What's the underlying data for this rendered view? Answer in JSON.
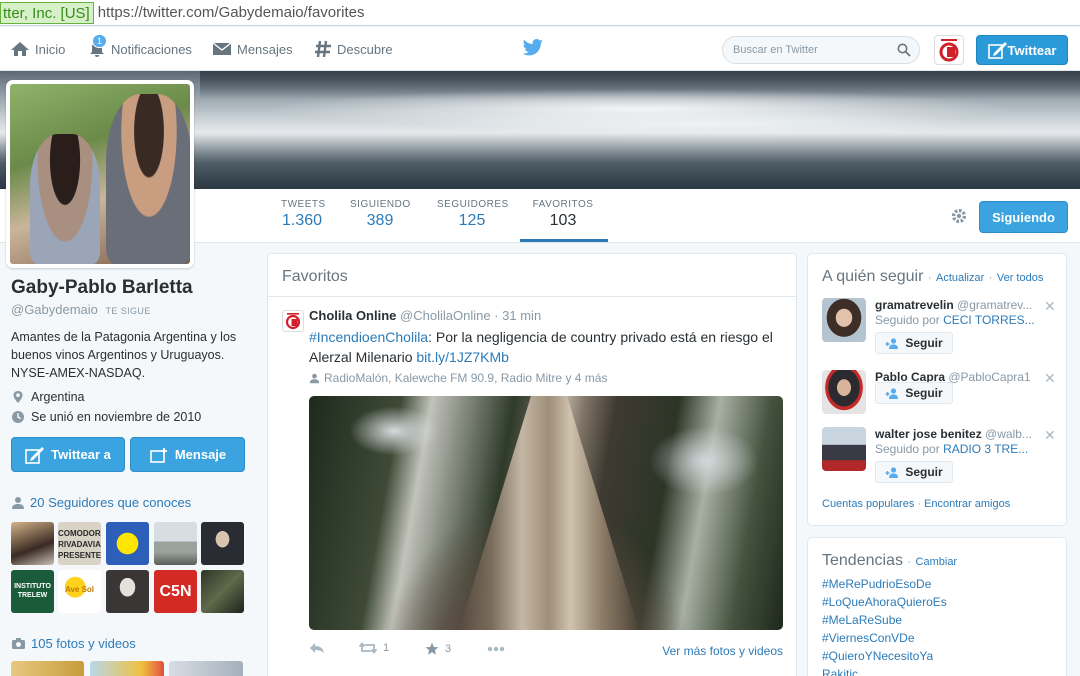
{
  "browser": {
    "cert_label": "tter, Inc. [US]",
    "url": "https://twitter.com/Gabydemaio/favorites"
  },
  "nav": {
    "home": "Inicio",
    "notifications": "Notificaciones",
    "notifications_badge": "1",
    "messages": "Mensajes",
    "discover": "Descubre",
    "search_placeholder": "Buscar en Twitter",
    "tweet_button": "Twittear"
  },
  "profile_nav": {
    "stats": [
      {
        "label": "TWEETS",
        "value": "1.360"
      },
      {
        "label": "SIGUIENDO",
        "value": "389"
      },
      {
        "label": "SEGUIDORES",
        "value": "125"
      },
      {
        "label": "FAVORITOS",
        "value": "103"
      }
    ],
    "following_button": "Siguiendo"
  },
  "profile": {
    "name": "Gaby-Pablo Barletta",
    "handle": "@Gabydemaio",
    "follows_you": "TE SIGUE",
    "bio": "Amantes de la Patagonia Argentina y los buenos vinos Argentinos y Uruguayos. NYSE-AMEX-NASDAQ.",
    "location": "Argentina",
    "joined": "Se unió en noviembre de 2010",
    "tweet_to_button": "Twittear a",
    "message_button": "Mensaje",
    "followers_you_know": "20 Seguidores que conoces",
    "photos_videos": "105 fotos y videos",
    "follower_thumbs": [
      {
        "label": ""
      },
      {
        "label": "COMODORO RIVADAVIA PRESENTE"
      },
      {
        "label": ""
      },
      {
        "label": ""
      },
      {
        "label": ""
      },
      {
        "label": "INSTITUTO TRELEW"
      },
      {
        "label": "Ave Sol"
      },
      {
        "label": ""
      },
      {
        "label": "C5N"
      },
      {
        "label": ""
      }
    ]
  },
  "favorites": {
    "title": "Favoritos",
    "tweet": {
      "author": "Cholila Online",
      "handle": "@CholilaOnline",
      "time": "31 min",
      "hashtag": "#IncendioenCholila",
      "text": ": Por la negligencia de country privado está en riesgo el Alerzal Milenario ",
      "link": "bit.ly/1JZ7KMb",
      "context": "RadioMalón, Kalewche FM 90.9, Radio Mitre y 4 más",
      "retweets": "1",
      "favorites": "3",
      "more_media": "Ver más fotos y videos"
    }
  },
  "who_to_follow": {
    "title": "A quién seguir",
    "refresh": "Actualizar",
    "view_all": "Ver todos",
    "suggestions": [
      {
        "name": "gramatrevelin",
        "handle": "@gramatrev...",
        "followed_by_prefix": "Seguido por ",
        "followed_by": "CECI TORRES...",
        "follow": "Seguir"
      },
      {
        "name": "Pablo Capra",
        "handle": "@PabloCapra1",
        "followed_by_prefix": "",
        "followed_by": "",
        "follow": "Seguir"
      },
      {
        "name": "walter jose benitez",
        "handle": "@walb...",
        "followed_by_prefix": "Seguido por ",
        "followed_by": "RADIO 3 TRE...",
        "follow": "Seguir"
      }
    ],
    "popular_accounts": "Cuentas populares",
    "find_friends": "Encontrar amigos"
  },
  "trends": {
    "title": "Tendencias",
    "change": "Cambiar",
    "items": [
      "#MeRePudrioEsoDe",
      "#LoQueAhoraQuieroEs",
      "#MeLaReSube",
      "#ViernesConVDe",
      "#QuieroYNecesitoYa",
      "Rakitic"
    ]
  },
  "colors": {
    "accent": "#2b7bb9",
    "button_blue": "#3ba3e0",
    "text": "#292f33",
    "muted": "#8899a6"
  }
}
